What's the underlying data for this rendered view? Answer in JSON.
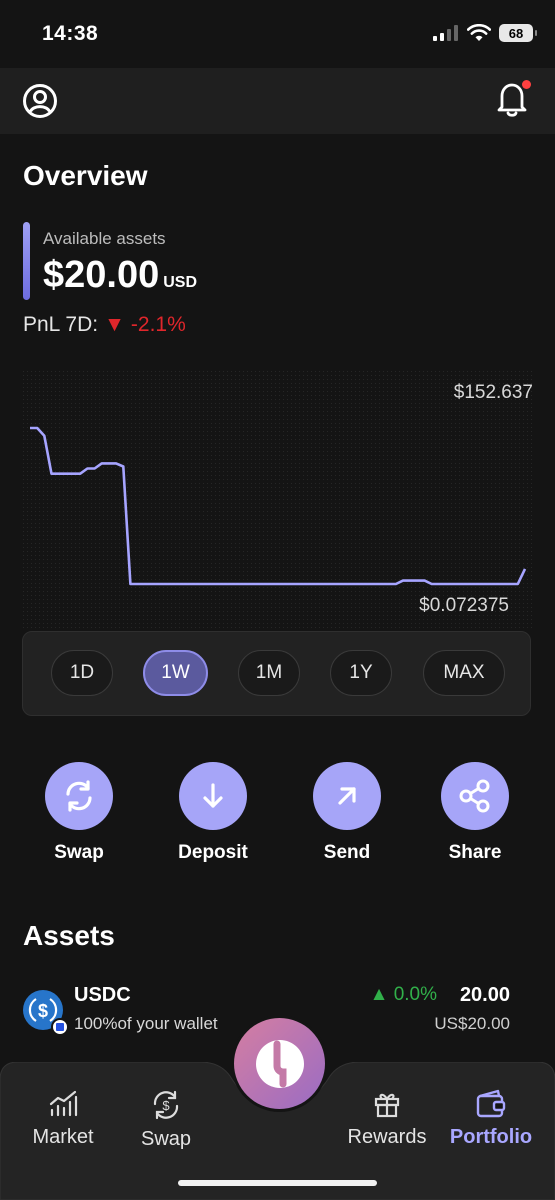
{
  "status_bar": {
    "time": "14:38",
    "battery": "68"
  },
  "top_bar": {
    "profile_icon": "user-circle-icon",
    "bell_icon": "bell-icon"
  },
  "overview": {
    "title": "Overview",
    "available_label": "Available assets",
    "balance": "$20.00",
    "currency": "USD",
    "pnl_label": "PnL 7D:",
    "pnl_arrow": "▼",
    "pnl_value": "-2.1%"
  },
  "chart_data": {
    "type": "line",
    "y_max_label": "$152.637",
    "y_min_label": "$0.072375",
    "line_color": "#a6a4ff",
    "series": [
      {
        "values": [
          152.6,
          152.6,
          145.0,
          108.0,
          108.0,
          108.0,
          108.0,
          108.0,
          113.0,
          113.0,
          118.0,
          118.0,
          118.0,
          115.0,
          0.2,
          0.2,
          0.2,
          0.2,
          0.2,
          0.2,
          0.2,
          0.2,
          0.2,
          0.2,
          0.2,
          0.2,
          0.2,
          0.2,
          0.2,
          0.2,
          0.2,
          0.2,
          0.2,
          0.2,
          0.2,
          0.2,
          0.2,
          0.2,
          0.2,
          0.2,
          0.2,
          0.2,
          0.2,
          0.2,
          0.2,
          0.2,
          0.2,
          0.2,
          0.2,
          0.2,
          0.2,
          0.2,
          3.5,
          3.5,
          3.5,
          3.5,
          0.2,
          0.2,
          0.2,
          0.2,
          0.2,
          0.2,
          0.2,
          0.2,
          0.2,
          0.2,
          0.2,
          0.2,
          0.2,
          15.0
        ]
      }
    ]
  },
  "ranges": [
    "1D",
    "1W",
    "1M",
    "1Y",
    "MAX"
  ],
  "active_range": "1W",
  "actions": [
    {
      "label": "Swap",
      "icon": "swap-arrows-icon"
    },
    {
      "label": "Deposit",
      "icon": "arrow-down-icon"
    },
    {
      "label": "Send",
      "icon": "arrow-up-right-icon"
    },
    {
      "label": "Share",
      "icon": "share-icon"
    }
  ],
  "assets": {
    "title": "Assets",
    "items": [
      {
        "name": "USDC",
        "share": "100%of your wallet",
        "change_arrow": "▲",
        "change": "0.0%",
        "amount": "20.00",
        "fiat": "US$20.00",
        "icon": "usdc-icon"
      }
    ]
  },
  "nav": {
    "items": [
      {
        "label": "Market",
        "icon": "chart-icon"
      },
      {
        "label": "Swap",
        "icon": "swap-dollar-icon"
      },
      {
        "label": "Rewards",
        "icon": "gift-icon"
      },
      {
        "label": "Portfolio",
        "icon": "wallet-icon"
      }
    ],
    "active": "Portfolio"
  },
  "colors": {
    "accent": "#a6a5f8",
    "negative": "#e0262b",
    "positive": "#31b04a",
    "background": "#141414"
  }
}
